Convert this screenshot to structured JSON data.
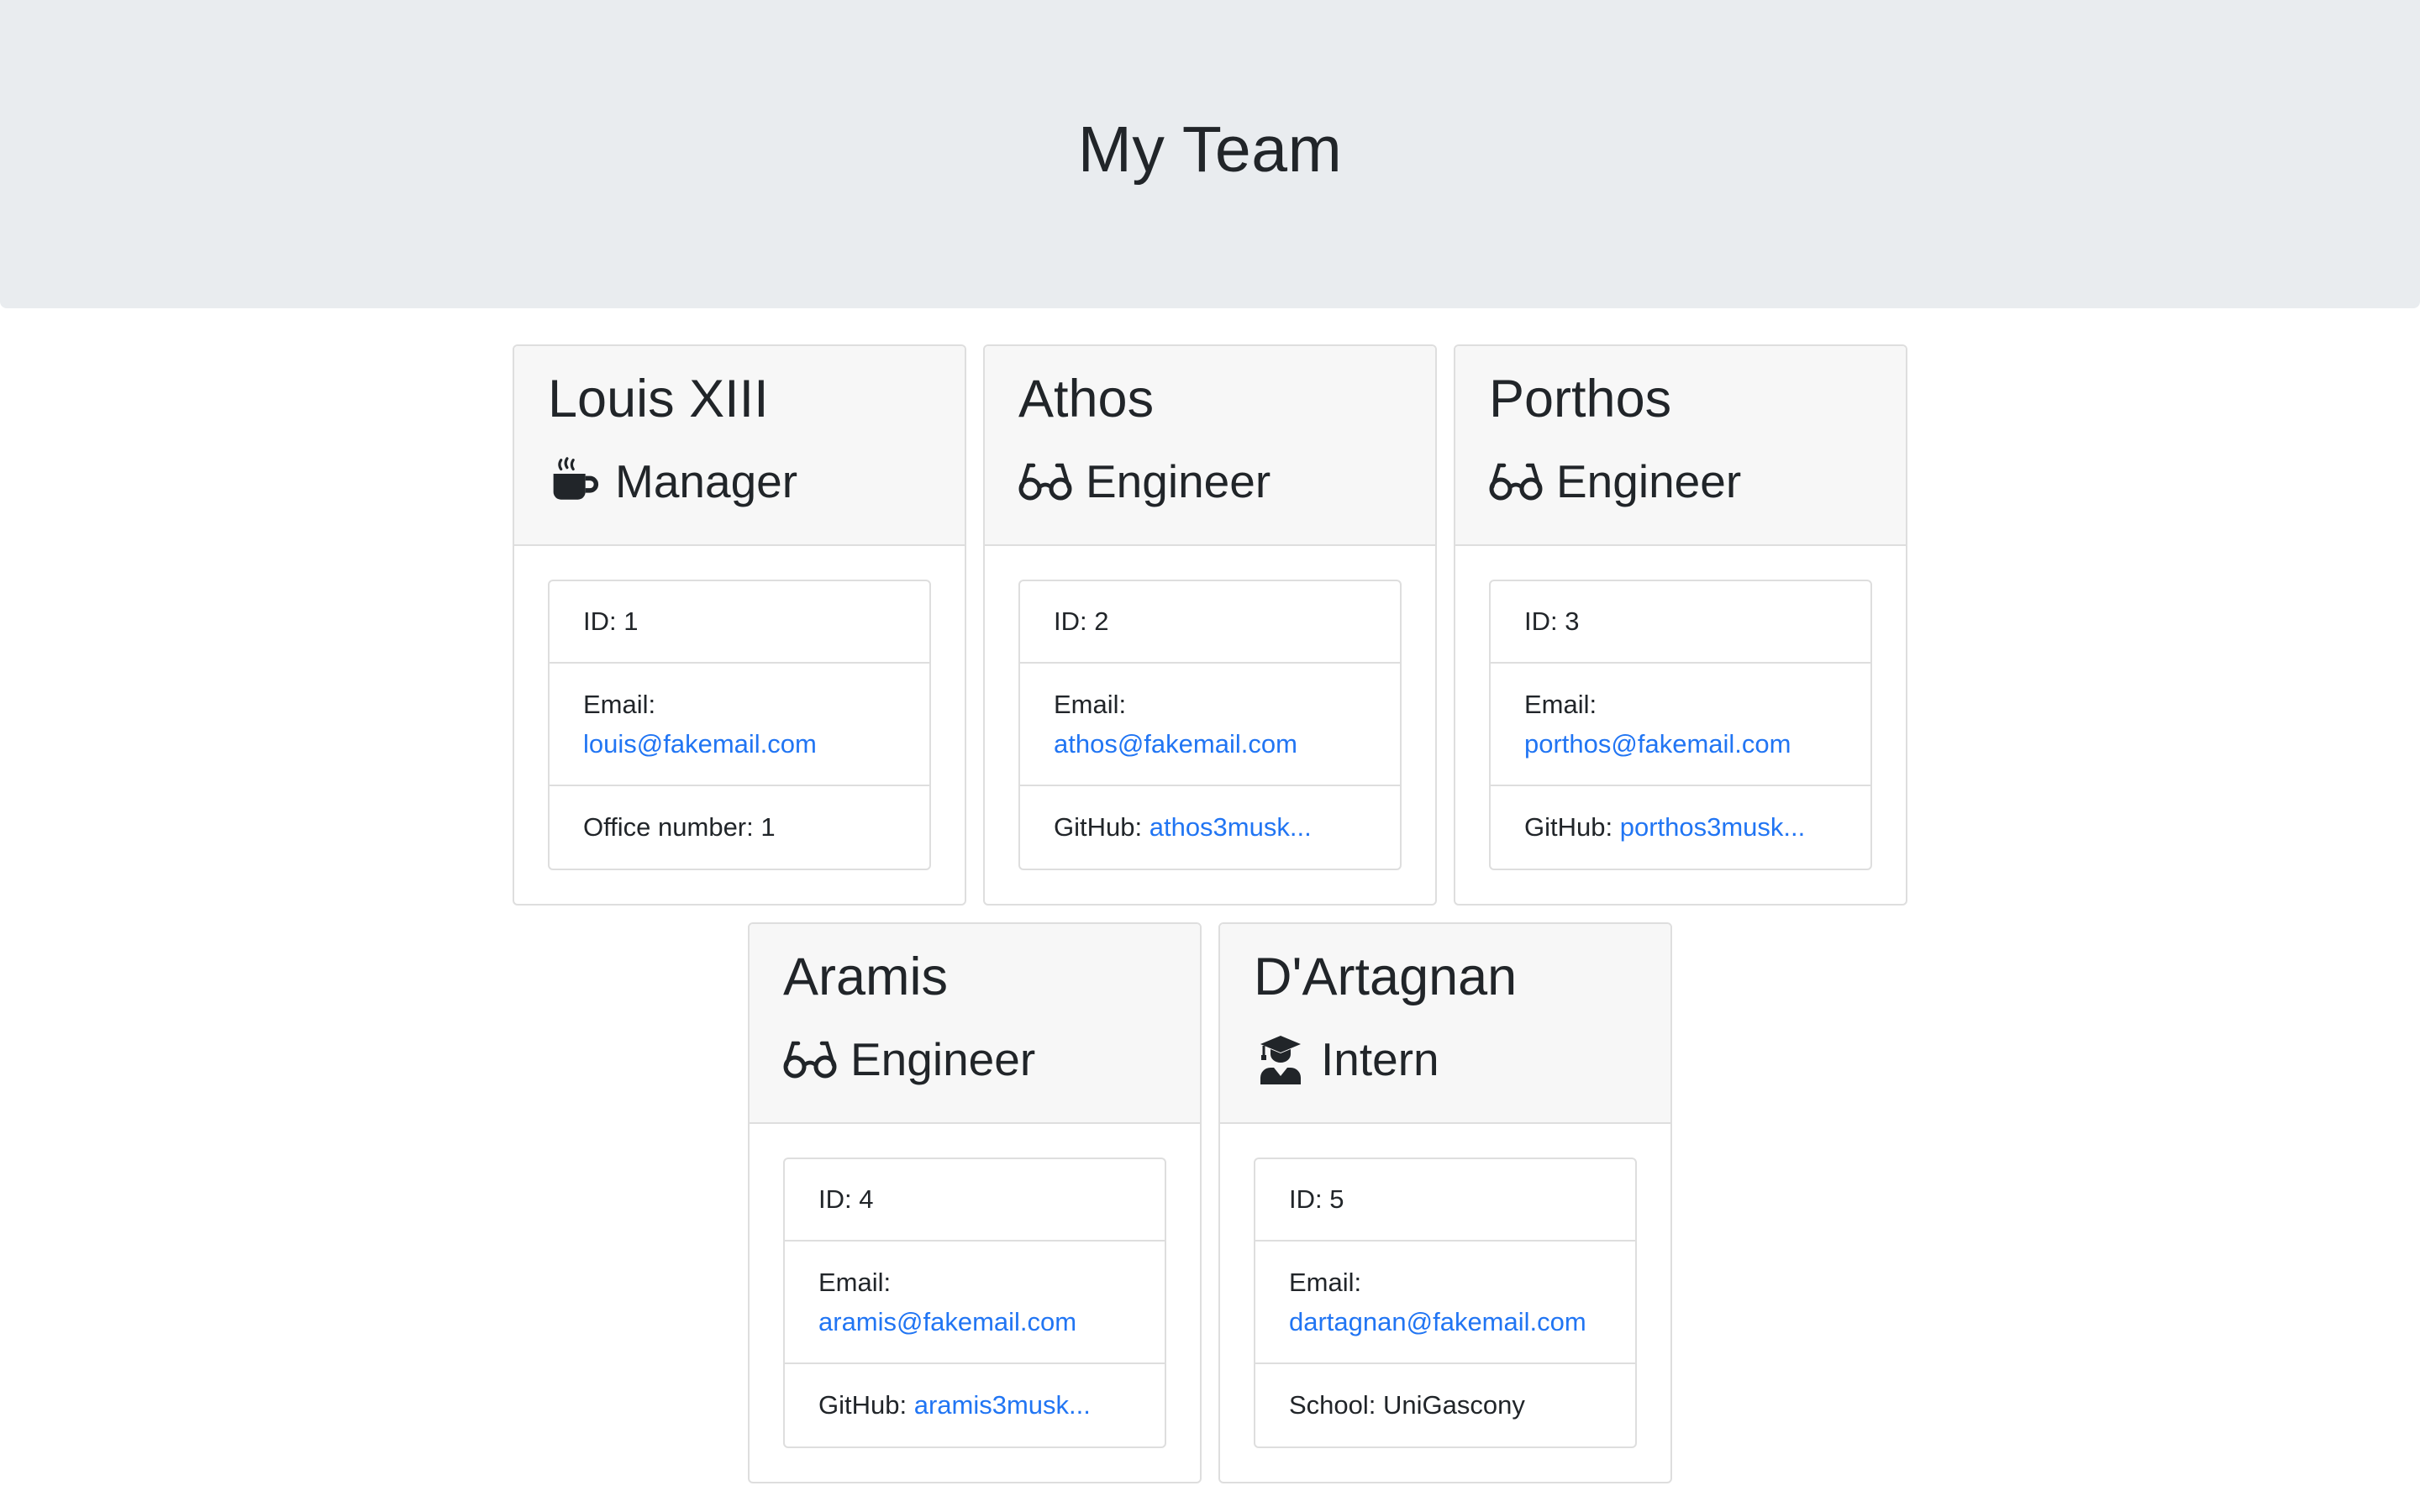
{
  "header": {
    "title": "My Team"
  },
  "labels": {
    "id": "ID: ",
    "email": "Email:",
    "office": "Office number: ",
    "github": "GitHub: ",
    "school": "School: "
  },
  "members": [
    {
      "name": "Louis XIII",
      "role": "Manager",
      "role_icon": "coffee-mug-icon",
      "id": "1",
      "email": "louis@fakemail.com",
      "extra_value": "1"
    },
    {
      "name": "Athos",
      "role": "Engineer",
      "role_icon": "glasses-icon",
      "id": "2",
      "email": "athos@fakemail.com",
      "extra_value": "athos3musk..."
    },
    {
      "name": "Porthos",
      "role": "Engineer",
      "role_icon": "glasses-icon",
      "id": "3",
      "email": "porthos@fakemail.com",
      "extra_value": "porthos3musk..."
    },
    {
      "name": "Aramis",
      "role": "Engineer",
      "role_icon": "glasses-icon",
      "id": "4",
      "email": "aramis@fakemail.com",
      "extra_value": "aramis3musk..."
    },
    {
      "name": "D'Artagnan",
      "role": "Intern",
      "role_icon": "graduate-icon",
      "id": "5",
      "email": "dartagnan@fakemail.com",
      "extra_value": "UniGascony"
    }
  ],
  "colors": {
    "jumbotron_bg": "#e9ecef",
    "card_header_bg": "#f7f7f7",
    "link": "#2175f3",
    "text": "#212529"
  }
}
